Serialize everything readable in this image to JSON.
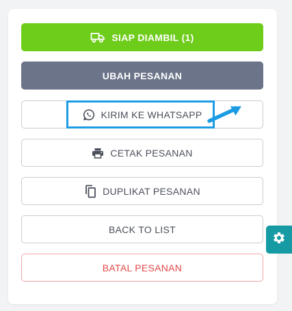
{
  "actions": {
    "ready_pickup": "SIAP DIAMBIL (1)",
    "edit_order": "UBAH PESANAN",
    "send_whatsapp": "KIRIM KE WHATSAPP",
    "print_order": "CETAK PESANAN",
    "duplicate_order": "DUPLIKAT PESANAN",
    "back_to_list": "BACK TO LIST",
    "cancel_order": "BATAL PESANAN"
  },
  "icons": {
    "ready_pickup": "truck-icon",
    "send_whatsapp": "whatsapp-icon",
    "print_order": "printer-icon",
    "duplicate_order": "copy-icon",
    "settings_tab": "gear-icon"
  },
  "colors": {
    "primary": "#6ecc1a",
    "secondary": "#6b7488",
    "danger": "#e24747",
    "highlight": "#1a9be3",
    "settings_tab": "#169aa3"
  }
}
